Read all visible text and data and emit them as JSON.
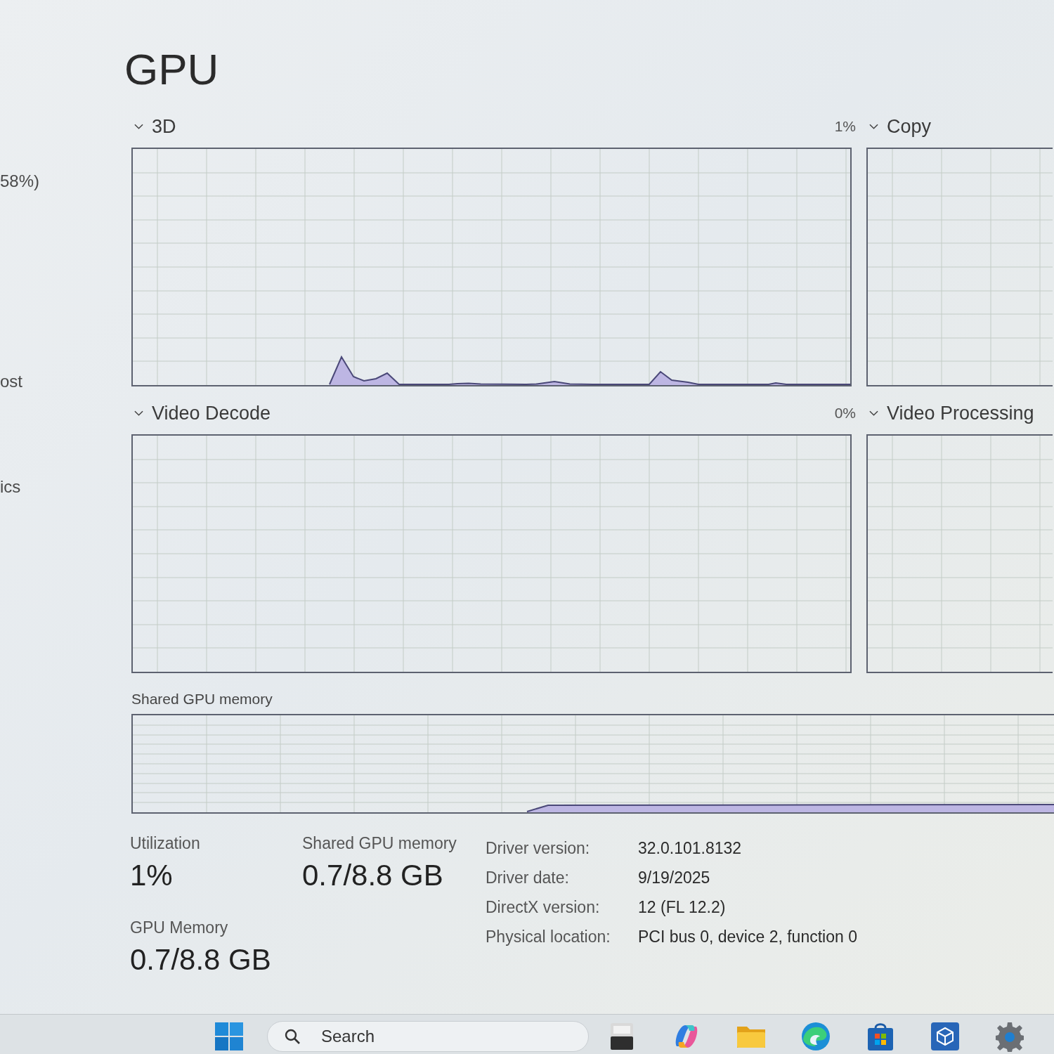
{
  "sidebar": {
    "items": [
      {
        "label": "58%)"
      },
      {
        "label": "ost"
      },
      {
        "label": "ics"
      }
    ]
  },
  "title": "GPU",
  "engines": [
    {
      "name": "3D",
      "reading": "1%",
      "activity": true
    },
    {
      "name": "Copy",
      "activity": false
    },
    {
      "name": "Video Decode",
      "reading": "0%",
      "activity": false
    },
    {
      "name": "Video Processing",
      "activity": false
    }
  ],
  "shared_memory_graph": {
    "label": "Shared GPU memory",
    "activity": true
  },
  "stats": [
    {
      "label": "Utilization",
      "value": "1%"
    },
    {
      "label": "Shared GPU memory",
      "value": "0.7/8.8 GB"
    },
    {
      "label": "GPU Memory",
      "value": "0.7/8.8 GB"
    }
  ],
  "properties": [
    {
      "label": "Driver version:",
      "value": "32.0.101.8132"
    },
    {
      "label": "Driver date:",
      "value": "9/19/2025"
    },
    {
      "label": "DirectX version:",
      "value": "12 (FL 12.2)"
    },
    {
      "label": "Physical location:",
      "value": "PCI bus 0, device 2, function 0"
    }
  ],
  "taskbar": {
    "search": {
      "placeholder": "Search"
    }
  }
}
